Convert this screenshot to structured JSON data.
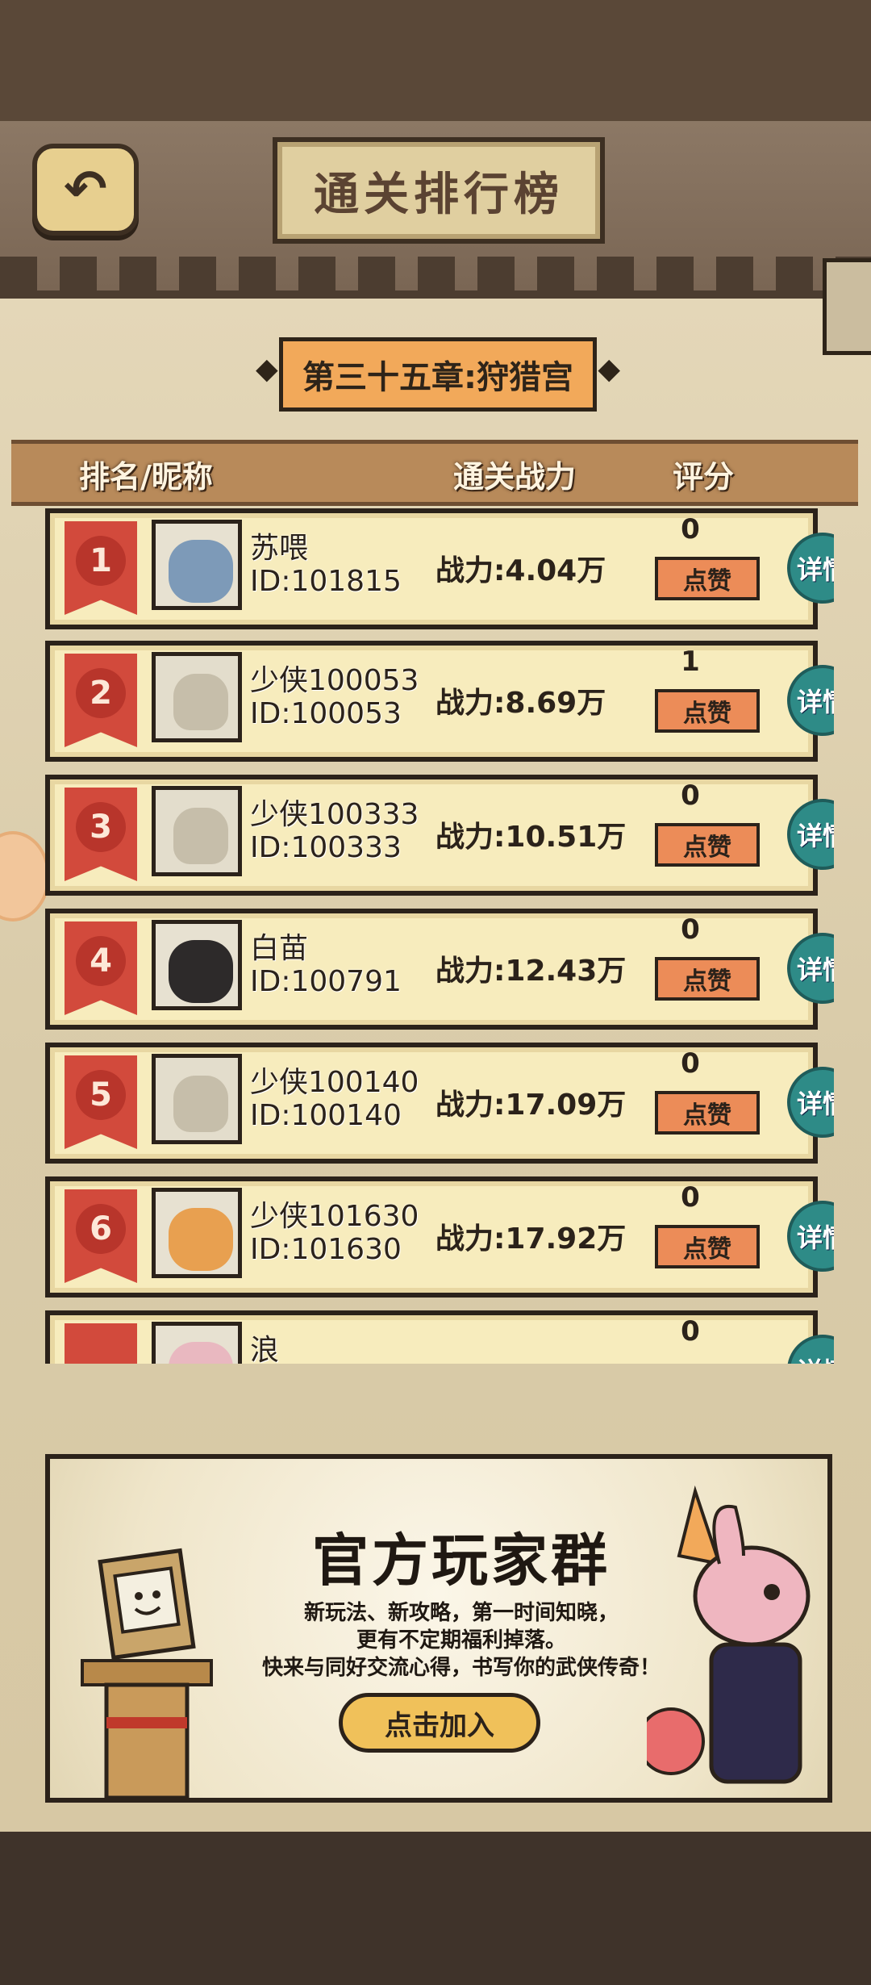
{
  "header": {
    "title": "通关排行榜",
    "back_icon": "back-arrow-icon",
    "chapter": "第三十五章:狩猎宫"
  },
  "columns": {
    "rank_name": "排名/昵称",
    "power": "通关战力",
    "score": "评分"
  },
  "rows": [
    {
      "rank": "1",
      "nickname": "苏喂",
      "id": "ID:101815",
      "power": "战力:4.04万",
      "score": "0",
      "like": "点赞",
      "detail": "详情",
      "avatar": "wolf-avatar"
    },
    {
      "rank": "2",
      "nickname": "少侠100053",
      "id": "ID:100053",
      "power": "战力:8.69万",
      "score": "1",
      "like": "点赞",
      "detail": "详情",
      "avatar": "default-avatar"
    },
    {
      "rank": "3",
      "nickname": "少侠100333",
      "id": "ID:100333",
      "power": "战力:10.51万",
      "score": "0",
      "like": "点赞",
      "detail": "详情",
      "avatar": "default-avatar"
    },
    {
      "rank": "4",
      "nickname": "白苗",
      "id": "ID:100791",
      "power": "战力:12.43万",
      "score": "0",
      "like": "点赞",
      "detail": "详情",
      "avatar": "penguin-avatar"
    },
    {
      "rank": "5",
      "nickname": "少侠100140",
      "id": "ID:100140",
      "power": "战力:17.09万",
      "score": "0",
      "like": "点赞",
      "detail": "详情",
      "avatar": "default-avatar"
    },
    {
      "rank": "6",
      "nickname": "少侠101630",
      "id": "ID:101630",
      "power": "战力:17.92万",
      "score": "0",
      "like": "点赞",
      "detail": "详情",
      "avatar": "tiger-avatar"
    },
    {
      "rank": "",
      "nickname": "浪",
      "id": "",
      "power": "",
      "score": "0",
      "like": "",
      "detail": "详情",
      "avatar": "pink-avatar"
    }
  ],
  "banner": {
    "title": "官方玩家群",
    "line1": "新玩法、新攻略，第一时间知晓，",
    "line2": "更有不定期福利掉落。",
    "line3": "快来与同好交流心得，书写你的武侠传奇！",
    "join": "点击加入"
  },
  "colors": {
    "rank_red": "#d24a3c",
    "like_orange": "#ec8c58",
    "detail_teal": "#2e8b87",
    "chapter_orange": "#f2a95a"
  }
}
